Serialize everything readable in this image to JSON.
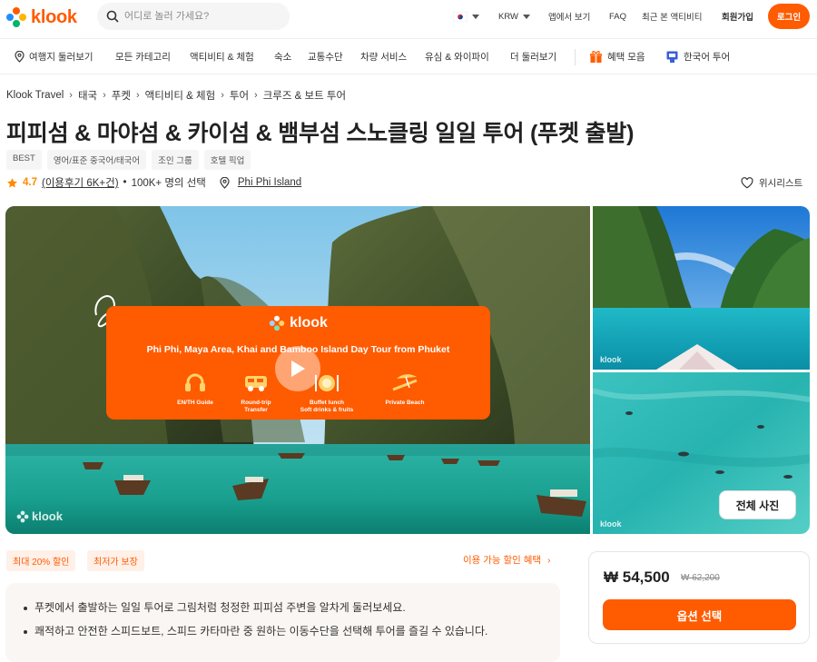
{
  "header": {
    "logo_text": "klook",
    "search_placeholder": "어디로 놀러 가세요?",
    "currency": "KRW",
    "nav": [
      "앱에서 보기",
      "FAQ",
      "최근 본 액티비티",
      "회원가입"
    ],
    "login": "로그인"
  },
  "categories": [
    "여행지 둘러보기",
    "모든 카테고리",
    "액티비티 & 체험",
    "숙소",
    "교통수단",
    "차량 서비스",
    "유심 & 와이파이",
    "더 둘러보기",
    "혜택 모음",
    "한국어 투어"
  ],
  "breadcrumb": [
    "Klook Travel",
    "태국",
    "푸켓",
    "액티비티 & 체험",
    "투어",
    "크루즈 & 보트 투어"
  ],
  "title": "피피섬 & 마야섬 & 카이섬 & 뱀부섬 스노클링 일일 투어 (푸켓 출발)",
  "tags": [
    "BEST",
    "영어/표준 중국어/태국어",
    "조인 그룹",
    "호텔 픽업"
  ],
  "rating": {
    "score": "4.7",
    "reviews": "(이용후기 6K+건)",
    "dot": "•",
    "booked": "100K+ 명의 선택",
    "location": "Phi Phi Island"
  },
  "wishlist": "위시리스트",
  "banner": {
    "logo": "klook",
    "title": "Phi Phi, Maya Area, Khai and Bamboo Island Day Tour  from Phuket",
    "features": [
      {
        "line1": "EN/TH Guide",
        "line2": ""
      },
      {
        "line1": "Round-trip",
        "line2": "Transfer"
      },
      {
        "line1": "Buffet lunch",
        "line2": "Soft drinks & fruits"
      },
      {
        "line1": "Private Beach",
        "line2": ""
      }
    ],
    "watermark": "klook"
  },
  "side_watermark": "klook",
  "all_photos": "전체 사진",
  "promos": [
    "최대 20% 할인",
    "최저가 보장"
  ],
  "promo_link": "이용 가능 할인 혜택",
  "highlights": [
    "푸켓에서 출발하는 일일 투어로 그림처럼 청정한 피피섬 주변을 알차게 둘러보세요.",
    "쾌적하고 안전한 스피드보트, 스피드 카타마란 중 원하는 이동수단을 선택해 투어를 즐길 수 있습니다."
  ],
  "price": {
    "current": "₩ 54,500",
    "original": "₩ 62,200",
    "button": "옵션 선택"
  },
  "colors": {
    "brand": "#ff5b00",
    "star": "#ff8a00"
  }
}
